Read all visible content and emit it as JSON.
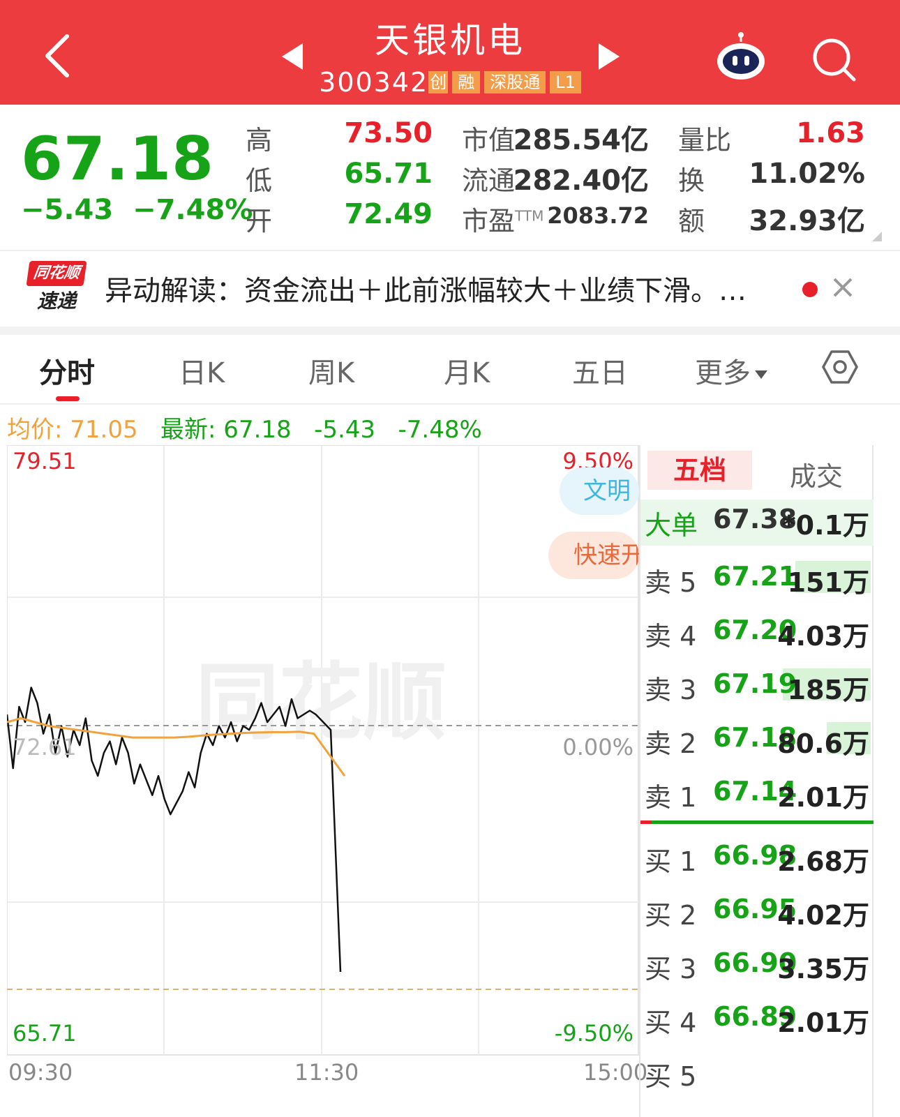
{
  "header": {
    "title": "天银机电",
    "code": "300342",
    "tags": [
      "创",
      "融",
      "深股通",
      "L1"
    ]
  },
  "quote": {
    "price": "67.18",
    "change": "−5.43",
    "change_pct": "−7.48%",
    "high_label": "高",
    "high": "73.50",
    "low_label": "低",
    "low": "65.71",
    "open_label": "开",
    "open": "72.49",
    "mcap_label": "市值",
    "mcap": "285.54亿",
    "float_label": "流通",
    "float": "282.40亿",
    "pe_label": "市盈",
    "pe_sup": "TTM",
    "pe": "2083.72",
    "vr_label": "量比",
    "vr": "1.63",
    "turnover_label": "换",
    "turnover": "11.02%",
    "amount_label": "额",
    "amount": "32.93亿"
  },
  "news": {
    "logo_top": "同花顺",
    "logo_bottom": "速递",
    "text": "异动解读：资金流出＋此前涨幅较大＋业绩下滑。…"
  },
  "tabs": [
    "分时",
    "日K",
    "周K",
    "月K",
    "五日",
    "更多"
  ],
  "legend": {
    "avg": "均价: 71.05",
    "latest": "最新: 67.18",
    "chg": "-5.43",
    "pct": "-7.48%"
  },
  "chart_axes": {
    "top_price": "79.51",
    "top_pct": "9.50%",
    "mid_price": "72.61",
    "mid_pct": "0.00%",
    "bottom_price": "65.71",
    "bottom_pct": "-9.50%",
    "t0": "09:30",
    "t1": "11:30",
    "t2": "15:00",
    "watermark": "同花顺"
  },
  "pills": {
    "blue": "文明",
    "orange": "快速开"
  },
  "order_book": {
    "tab_active": "五档",
    "tab_other": "成交",
    "big_order": {
      "label": "大单",
      "price": "67.38",
      "vol": "*0.1万"
    },
    "asks": [
      {
        "label": "卖 5",
        "price": "67.21",
        "vol": "151万",
        "bar": 0.6
      },
      {
        "label": "卖 4",
        "price": "67.20",
        "vol": "4.03万",
        "bar": 0
      },
      {
        "label": "卖 3",
        "price": "67.19",
        "vol": "185万",
        "bar": 0.7
      },
      {
        "label": "卖 2",
        "price": "67.18",
        "vol": "80.6万",
        "bar": 0.35
      },
      {
        "label": "卖 1",
        "price": "67.14",
        "vol": "2.01万",
        "bar": 0
      }
    ],
    "bids": [
      {
        "label": "买 1",
        "price": "66.98",
        "vol": "2.68万"
      },
      {
        "label": "买 2",
        "price": "66.95",
        "vol": "4.02万"
      },
      {
        "label": "买 3",
        "price": "66.90",
        "vol": "3.35万"
      },
      {
        "label": "买 4",
        "price": "66.89",
        "vol": "2.01万"
      },
      {
        "label": "买 5",
        "price": "",
        "vol": ""
      }
    ]
  },
  "chart_data": {
    "type": "line",
    "prev_close": 72.61,
    "ylim": [
      65.71,
      79.51
    ],
    "x_ticks": [
      "09:30",
      "11:30",
      "15:00"
    ],
    "series": [
      {
        "values": [
          72.9,
          71.5,
          73.1,
          72.7,
          73.6,
          73.2,
          72.4,
          72.9,
          71.9,
          72.6,
          71.8,
          72.5,
          72.1,
          72.8,
          71.7,
          71.3,
          71.9,
          72.2,
          71.6,
          72.3,
          71.9,
          71.1,
          71.6,
          71.2,
          70.8,
          71.3,
          70.7,
          70.3,
          70.6,
          70.9,
          71.4,
          71.0,
          71.9,
          72.4,
          72.1,
          72.6,
          72.3,
          72.7,
          72.2,
          72.6,
          72.5,
          72.8,
          73.2,
          72.7,
          72.9,
          73.1,
          72.6,
          73.3,
          72.8,
          72.9,
          73.0,
          72.9,
          72.5,
          66.2
        ],
        "color": "#111111"
      },
      {
        "values": [
          72.7,
          72.8,
          72.7,
          72.6,
          72.55,
          72.5,
          72.45,
          72.4,
          72.35,
          72.3,
          72.3,
          72.3,
          72.3,
          72.32,
          72.35,
          72.38,
          72.4,
          72.42,
          72.43,
          72.44,
          72.44,
          72.45,
          72.4,
          71.3
        ],
        "color": "#f2a23c"
      }
    ]
  }
}
